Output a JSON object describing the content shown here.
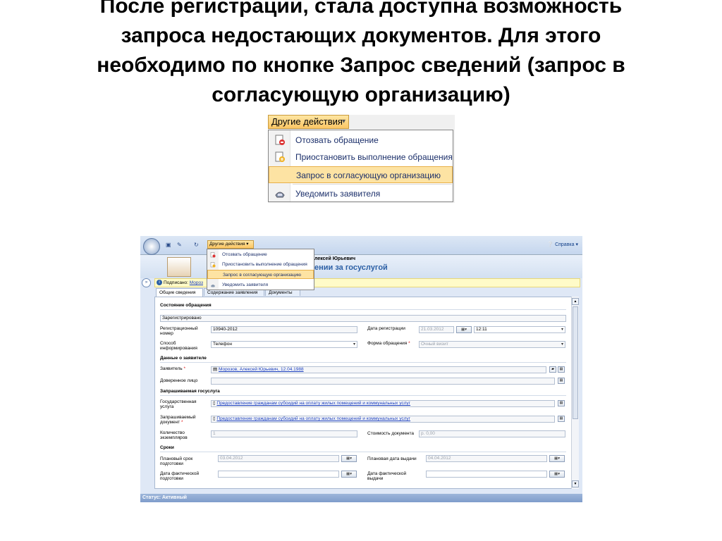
{
  "slide": {
    "title": "После регистрации, стала доступна возможность\nзапроса недостающих документов. Для этого\nнеобходимо по кнопке Запрос сведений (запрос в\nсогласующую организацию)"
  },
  "menu": {
    "button_label": "Другие действия",
    "items": [
      {
        "label": "Отозвать обращение",
        "icon": "recall-doc-icon"
      },
      {
        "label": "Приостановить выполнение обращения",
        "icon": "pause-doc-icon"
      },
      {
        "label": "Запрос в согласующую организацию",
        "icon": "",
        "highlighted": true
      },
      {
        "label": "Уведомить заявителя",
        "icon": "notify-phone-icon"
      }
    ]
  },
  "app": {
    "help_label": "Справка",
    "header_name": "лексей Юрьевич",
    "header_subtitle": "ении за госуслугой",
    "notice_prefix": "Подписано:",
    "notice_link": "Мороз",
    "tabs": [
      "Общие сведения",
      "Содержание заявления",
      "Документы"
    ],
    "sections": {
      "status": "Состояние обращения",
      "applicant": "Данные о заявителе",
      "service": "Запрашиваемая госуслуга",
      "terms": "Сроки"
    },
    "fields": {
      "state_value": "Зарегистрировано",
      "reg_number_label": "Регистрационный номер",
      "reg_number_value": "10940-2012",
      "reg_date_label": "Дата регистрации",
      "reg_date_value": "21.03.2012",
      "reg_time_value": "12:11",
      "method_label": "Способ информирования",
      "method_value": "Телефон",
      "form_label": "Форма обращения",
      "form_value": "Очный визит",
      "applicant_label": "Заявитель",
      "applicant_value": "Морозов, Алексей Юрьевич, 12.04.1988",
      "trustee_label": "Доверенное лицо",
      "gov_service_label": "Государственная услуга",
      "gov_service_value": "Предоставление гражданам субсидий на оплату жилых помещений и коммунальных услуг",
      "req_doc_label": "Запрашиваемый документ",
      "req_doc_value": "Предоставление гражданам субсидий на оплату жилых помещений и коммунальных услуг",
      "copies_label": "Количество экземпляров",
      "copies_value": "1",
      "cost_label": "Стоимость документа",
      "cost_value": "р. 0,00",
      "plan_prep_label": "Плановый срок подготовки",
      "plan_prep_value": "03.04.2012",
      "plan_issue_label": "Плановая дата выдачи",
      "plan_issue_value": "04.04.2012",
      "actual_prep_label": "Дата фактической подготовки",
      "actual_issue_label": "Дата фактической выдачи"
    },
    "status_bar": "Статус: Активный"
  }
}
